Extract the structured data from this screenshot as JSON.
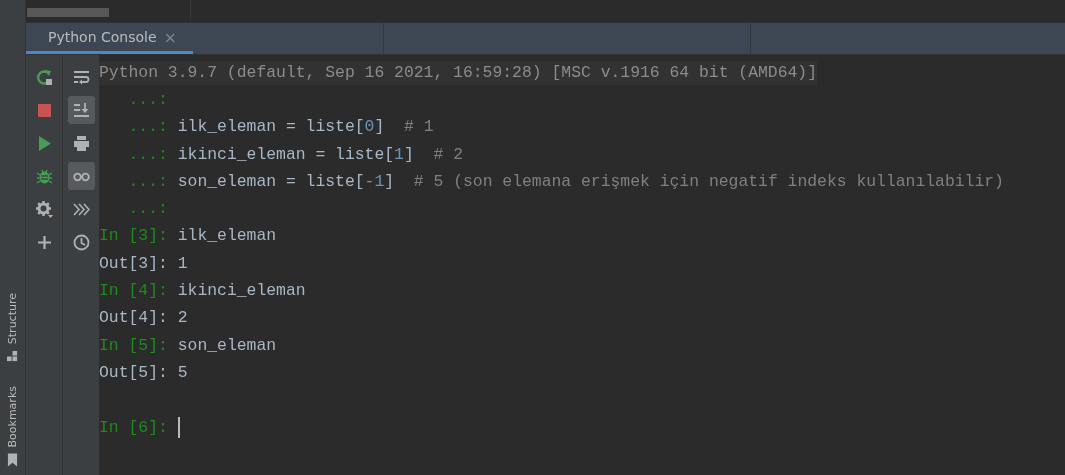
{
  "side_panel": [
    {
      "label": "Structure"
    },
    {
      "label": "Bookmarks"
    }
  ],
  "tabs": [
    {
      "label": "Python Console",
      "selected": true,
      "closable": "×"
    }
  ],
  "toolbar": [
    {
      "kind": "rerun"
    },
    {
      "kind": "stop"
    },
    {
      "kind": "run"
    },
    {
      "kind": "debug"
    },
    {
      "kind": "settings"
    },
    {
      "kind": "add"
    }
  ],
  "secondary_toolbar": [
    {
      "kind": "wrap",
      "selected": false
    },
    {
      "kind": "scroll-end",
      "selected": true
    },
    {
      "kind": "print",
      "selected": false
    },
    {
      "kind": "glasses",
      "selected": true
    },
    {
      "kind": "execute",
      "selected": false
    },
    {
      "kind": "history",
      "selected": false
    }
  ],
  "console": {
    "lines": [
      {
        "kind": "header",
        "text": "Python 3.9.7 (default, Sep 16 2021, 16:59:28) [MSC v.1916 64 bit (AMD64)]"
      },
      {
        "kind": "code",
        "segments": [
          {
            "kind": "prompt",
            "text": "   ...:"
          }
        ]
      },
      {
        "kind": "code",
        "segments": [
          {
            "kind": "prompt",
            "text": "   ...: "
          },
          {
            "kind": "text",
            "text": "ilk_eleman = liste["
          },
          {
            "kind": "number",
            "text": "0"
          },
          {
            "kind": "text",
            "text": "]  "
          },
          {
            "kind": "comment",
            "text": "# 1"
          }
        ]
      },
      {
        "kind": "code",
        "segments": [
          {
            "kind": "prompt",
            "text": "   ...: "
          },
          {
            "kind": "text",
            "text": "ikinci_eleman = liste["
          },
          {
            "kind": "number",
            "text": "1"
          },
          {
            "kind": "text",
            "text": "]  "
          },
          {
            "kind": "comment",
            "text": "# 2"
          }
        ]
      },
      {
        "kind": "code",
        "segments": [
          {
            "kind": "prompt",
            "text": "   ...: "
          },
          {
            "kind": "text",
            "text": "son_eleman = liste["
          },
          {
            "kind": "number",
            "text": "-1"
          },
          {
            "kind": "text",
            "text": "]  "
          },
          {
            "kind": "comment",
            "text": "# 5 (son elemana erişmek için negatif indeks kullanılabilir)"
          }
        ]
      },
      {
        "kind": "code",
        "segments": [
          {
            "kind": "prompt",
            "text": "   ...:"
          }
        ]
      },
      {
        "kind": "code",
        "segments": [
          {
            "kind": "prompt",
            "text": "In [3]: "
          },
          {
            "kind": "text",
            "text": "ilk_eleman"
          }
        ]
      },
      {
        "kind": "code",
        "segments": [
          {
            "kind": "text",
            "text": "Out[3]: 1"
          }
        ]
      },
      {
        "kind": "code",
        "segments": [
          {
            "kind": "prompt",
            "text": "In [4]: "
          },
          {
            "kind": "text",
            "text": "ikinci_eleman"
          }
        ]
      },
      {
        "kind": "code",
        "segments": [
          {
            "kind": "text",
            "text": "Out[4]: 2"
          }
        ]
      },
      {
        "kind": "code",
        "segments": [
          {
            "kind": "prompt",
            "text": "In [5]: "
          },
          {
            "kind": "text",
            "text": "son_eleman"
          }
        ]
      },
      {
        "kind": "code",
        "segments": [
          {
            "kind": "text",
            "text": "Out[5]: 5"
          }
        ]
      },
      {
        "kind": "blank"
      },
      {
        "kind": "input",
        "segments": [
          {
            "kind": "prompt",
            "text": "In [6]: "
          }
        ]
      }
    ]
  }
}
